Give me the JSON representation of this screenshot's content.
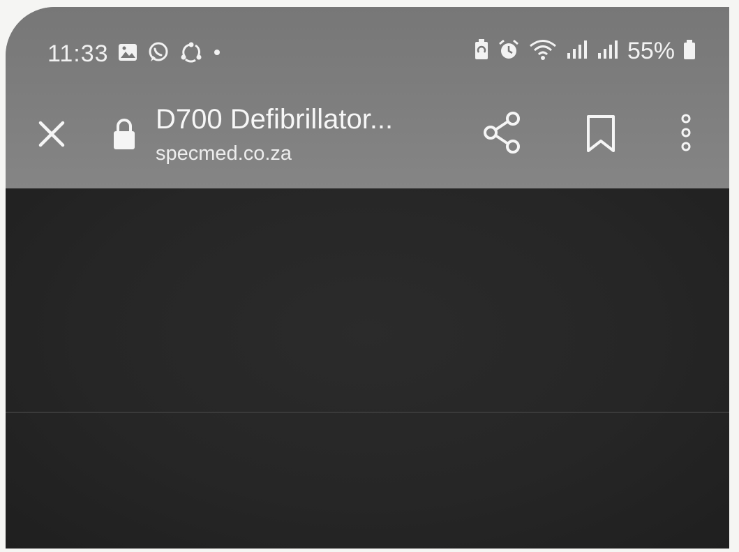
{
  "status_bar": {
    "time": "11:33",
    "battery": "55%",
    "left_icons": [
      "gallery-icon",
      "whatsapp-icon",
      "sync-icon",
      "dot-icon"
    ],
    "right_icons": [
      "battery-saver-icon",
      "alarm-icon",
      "wifi-icon",
      "signal-icon",
      "signal-icon",
      "battery-icon"
    ]
  },
  "toolbar": {
    "title": "D700 Defibrillator...",
    "domain": "specmed.co.za",
    "icons": [
      "close-icon",
      "lock-icon",
      "share-icon",
      "bookmark-icon",
      "more-vert-icon"
    ]
  },
  "colors": {
    "status_bar_bg": "#777777",
    "toolbar_bg": "#828282",
    "content_bg": "#262626",
    "text": "#f2f2f2"
  }
}
